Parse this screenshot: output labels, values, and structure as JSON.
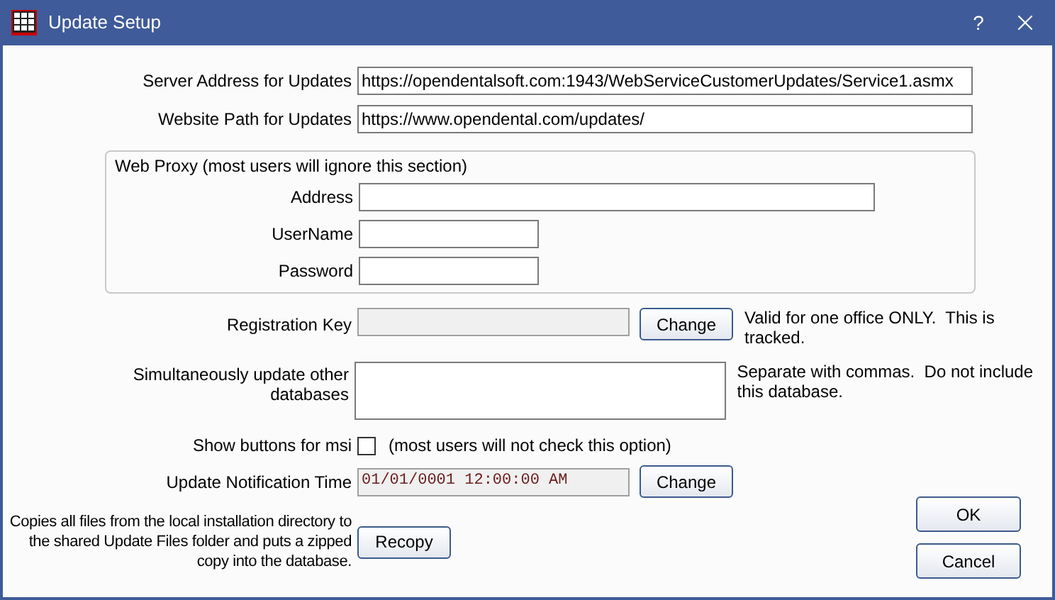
{
  "window": {
    "title": "Update Setup",
    "help": "?"
  },
  "fields": [
    {
      "label": "Server Address for Updates",
      "value": "https://opendentalsoft.com:1943/WebServiceCustomerUpdates/Service1.asmx"
    },
    {
      "label": "Website Path for Updates",
      "value": "https://www.opendental.com/updates/"
    }
  ],
  "web_proxy": {
    "title": "Web Proxy (most users will ignore this section)",
    "fields": [
      {
        "label": "Address",
        "kind": "wide"
      },
      {
        "label": "UserName",
        "kind": "narrow"
      },
      {
        "label": "Password",
        "kind": "narrow"
      }
    ]
  },
  "registration": {
    "label": "Registration Key",
    "disabled": true,
    "button": "Change",
    "note": "Valid for one office ONLY.  This is tracked."
  },
  "other_databases": {
    "label": "Simultaneously update other databases",
    "note": "Separate with commas.  Do not include this database."
  },
  "msi": {
    "label": "Show buttons for msi",
    "checked": false,
    "note": "(most users will not check this option)"
  },
  "notification": {
    "label": "Update Notification Time",
    "value": "01/01/0001 12:00:00 AM",
    "button": "Change"
  },
  "recopy": {
    "description": "Copies all files from the local installation directory to the shared Update Files folder and puts a zipped copy into the database.",
    "button": "Recopy"
  },
  "buttons": [
    "OK",
    "Cancel"
  ]
}
